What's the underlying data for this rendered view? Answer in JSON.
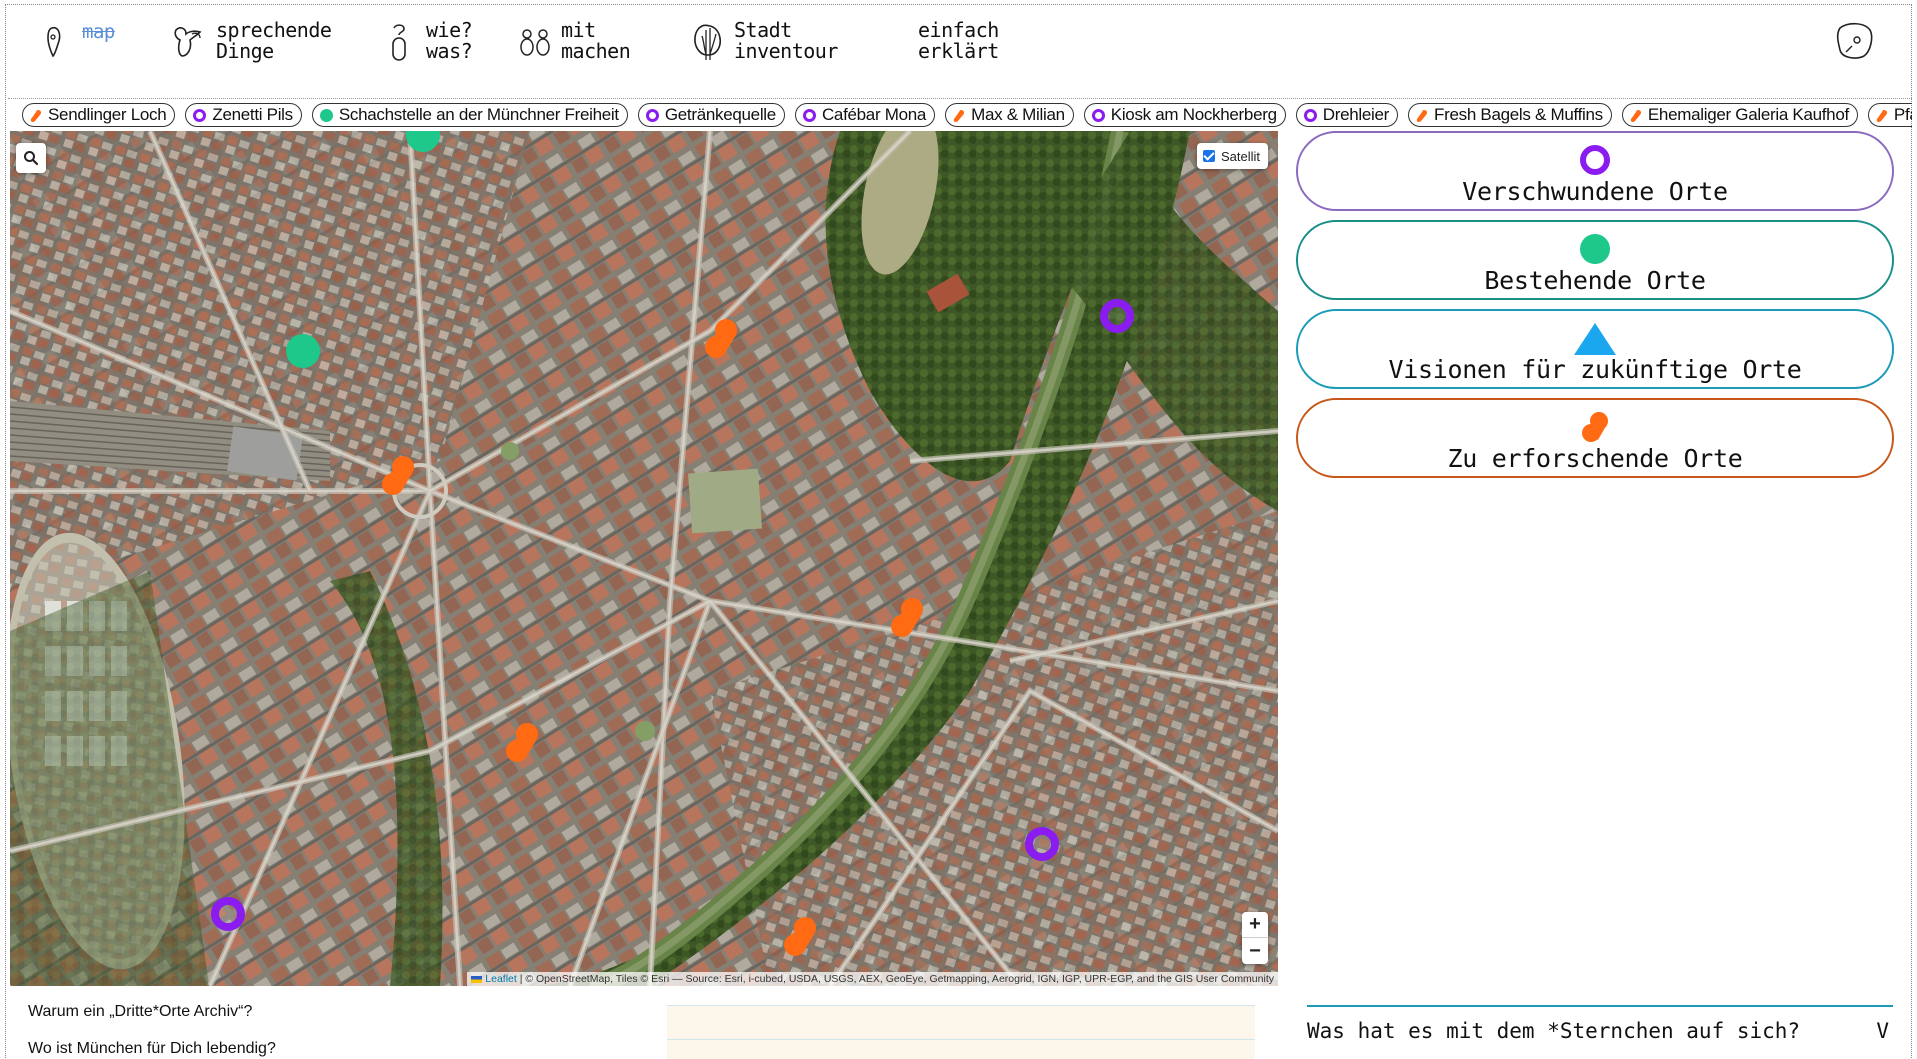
{
  "nav": {
    "items": [
      {
        "label": "map",
        "icon": "pin-outline-icon"
      },
      {
        "label": "sprechende\nDinge",
        "icon": "talking-object-icon"
      },
      {
        "label": "wie?\nwas?",
        "icon": "question-figure-icon"
      },
      {
        "label": "mit\nmachen",
        "icon": "people-icon"
      },
      {
        "label": "Stadt\ninventour",
        "icon": "tree-icon"
      },
      {
        "label": "einfach\nerklärt",
        "icon": ""
      }
    ],
    "profile_icon": "face-sketch-icon"
  },
  "ticker": [
    {
      "label": "Sendlinger Loch",
      "type": "orange"
    },
    {
      "label": "Zenetti Pils",
      "type": "purple"
    },
    {
      "label": "Schachstelle an der Münchner Freiheit",
      "type": "green"
    },
    {
      "label": "Getränkequelle",
      "type": "purple"
    },
    {
      "label": "Cafébar Mona",
      "type": "purple"
    },
    {
      "label": "Max & Milian",
      "type": "orange"
    },
    {
      "label": "Kiosk am Nockherberg",
      "type": "purple"
    },
    {
      "label": "Drehleier",
      "type": "purple"
    },
    {
      "label": "Fresh Bagels & Muffins",
      "type": "orange"
    },
    {
      "label": "Ehemaliger Galeria Kaufhof",
      "type": "orange"
    },
    {
      "label": "Pfann",
      "type": "orange"
    }
  ],
  "map": {
    "layer_toggle_label": "Satellit",
    "layer_toggle_checked": true,
    "zoom_in": "+",
    "zoom_out": "−",
    "attribution_leaflet": "Leaflet",
    "attribution_rest": " | © OpenStreetMap, Tiles © Esri — Source: Esri, i-cubed, USDA, USGS, AEX, GeoEye, Getmapping, Aerogrid, IGN, IGP, UPR-EGP, and the GIS User Community"
  },
  "legend": [
    {
      "label": "Verschwundene Orte",
      "color": "#8a6bbf",
      "symbol": "purple-ring"
    },
    {
      "label": "Bestehende Orte",
      "color": "#1a8f88",
      "symbol": "green-dot"
    },
    {
      "label": "Visionen für zukünftige Orte",
      "color": "#1c9bb8",
      "symbol": "blue-triangle"
    },
    {
      "label": "Zu erforschende Orte",
      "color": "#c8581a",
      "symbol": "orange-blob"
    }
  ],
  "faq_left": [
    "Warum ein „Dritte*Orte Archiv“?",
    "Wo ist München für Dich lebendig?"
  ],
  "faq_right": {
    "question": "Was hat es mit dem *Sternchen auf sich?",
    "toggle": "V"
  },
  "colors": {
    "purple": "#8a1cf0",
    "green": "#1ec88a",
    "orange": "#ff6a13",
    "blue": "#1aa7f0"
  }
}
